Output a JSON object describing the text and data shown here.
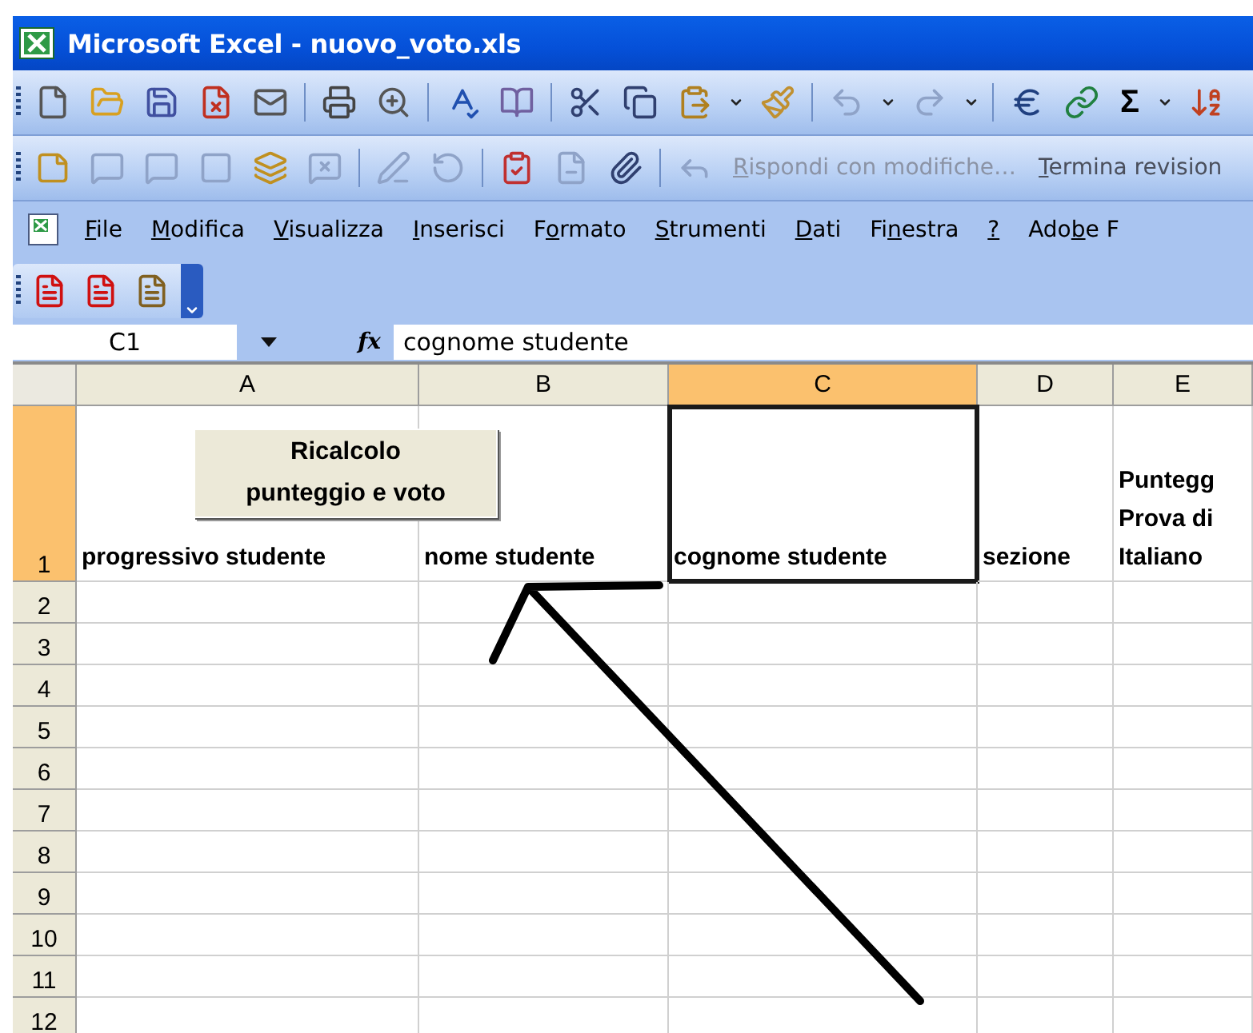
{
  "window": {
    "title": "Microsoft Excel - nuovo_voto.xls"
  },
  "standard_toolbar": {
    "autosum_label": "Σ"
  },
  "reviewing_toolbar": {
    "items": [
      {
        "key": "R",
        "post": "ispondi con modifiche…",
        "disabled": true
      },
      {
        "key": "T",
        "post": "ermina revision",
        "disabled": false
      }
    ]
  },
  "menu_bar": {
    "items": [
      {
        "key": "F",
        "post": "ile"
      },
      {
        "key": "M",
        "post": "odifica"
      },
      {
        "key": "V",
        "post": "isualizza"
      },
      {
        "key": "I",
        "post": "nserisci"
      },
      {
        "pre": "F",
        "key": "o",
        "post": "rmato"
      },
      {
        "key": "S",
        "post": "trumenti"
      },
      {
        "key": "D",
        "post": "ati"
      },
      {
        "pre": "Fi",
        "key": "n",
        "post": "estra"
      },
      {
        "key": "?"
      },
      {
        "pre": "Ado",
        "key": "b",
        "post": "e F"
      }
    ]
  },
  "formula_bar": {
    "name_box": "C1",
    "fx_label": "fx",
    "value": "cognome studente"
  },
  "sheet": {
    "columns": [
      {
        "label": "A",
        "selected": false
      },
      {
        "label": "B",
        "selected": false
      },
      {
        "label": "C",
        "selected": true
      },
      {
        "label": "D",
        "selected": false
      },
      {
        "label": "E",
        "selected": false
      }
    ],
    "rows": [
      {
        "label": "1",
        "selected": true,
        "cells": [
          {
            "lines": [
              "progressivo studente"
            ],
            "selected": false
          },
          {
            "lines": [
              "nome studente"
            ],
            "selected": false
          },
          {
            "lines": [
              "cognome studente"
            ],
            "selected": true
          },
          {
            "lines": [
              "sezione"
            ],
            "selected": false
          },
          {
            "lines": [
              "Puntegg",
              "Prova di",
              "Italiano"
            ],
            "selected": false
          }
        ]
      },
      {
        "label": "2",
        "selected": false
      },
      {
        "label": "3",
        "selected": false
      },
      {
        "label": "4",
        "selected": false
      },
      {
        "label": "5",
        "selected": false
      },
      {
        "label": "6",
        "selected": false
      },
      {
        "label": "7",
        "selected": false
      },
      {
        "label": "8",
        "selected": false
      },
      {
        "label": "9",
        "selected": false
      },
      {
        "label": "10",
        "selected": false
      },
      {
        "label": "11",
        "selected": false
      },
      {
        "label": "12",
        "selected": false
      }
    ],
    "macro_button": {
      "label": "Ricalcolo punteggio e voto"
    }
  }
}
